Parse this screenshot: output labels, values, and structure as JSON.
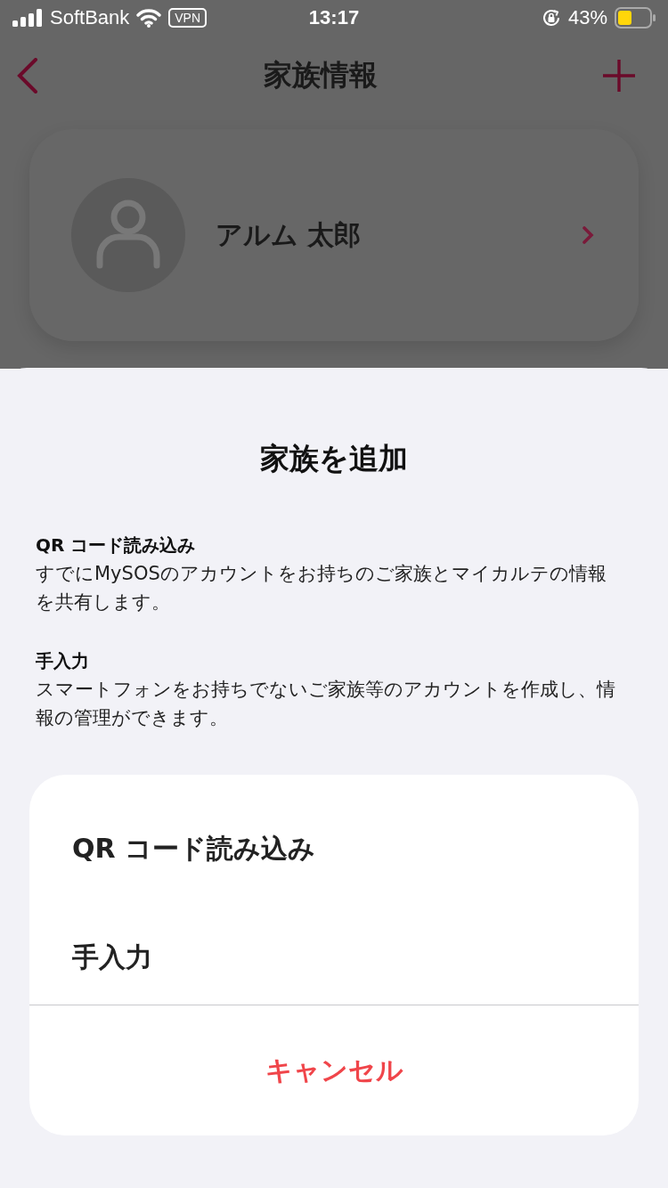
{
  "status_bar": {
    "carrier": "SoftBank",
    "vpn": "VPN",
    "time": "13:17",
    "battery": "43%"
  },
  "nav": {
    "title": "家族情報"
  },
  "family": [
    {
      "name": "アルム 太郎"
    }
  ],
  "sheet": {
    "title": "家族を追加",
    "sections": [
      {
        "heading": "QR コード読み込み",
        "text": "すでにMySOSのアカウントをお持ちのご家族とマイカルテの情報を共有します。"
      },
      {
        "heading": "手入力",
        "text": "スマートフォンをお持ちでないご家族等のアカウントを作成し、情報の管理ができます。"
      }
    ],
    "actions": [
      {
        "label": "QR コード読み込み",
        "kind": "option"
      },
      {
        "label": "手入力",
        "kind": "option"
      },
      {
        "label": "キャンセル",
        "kind": "cancel"
      }
    ]
  }
}
